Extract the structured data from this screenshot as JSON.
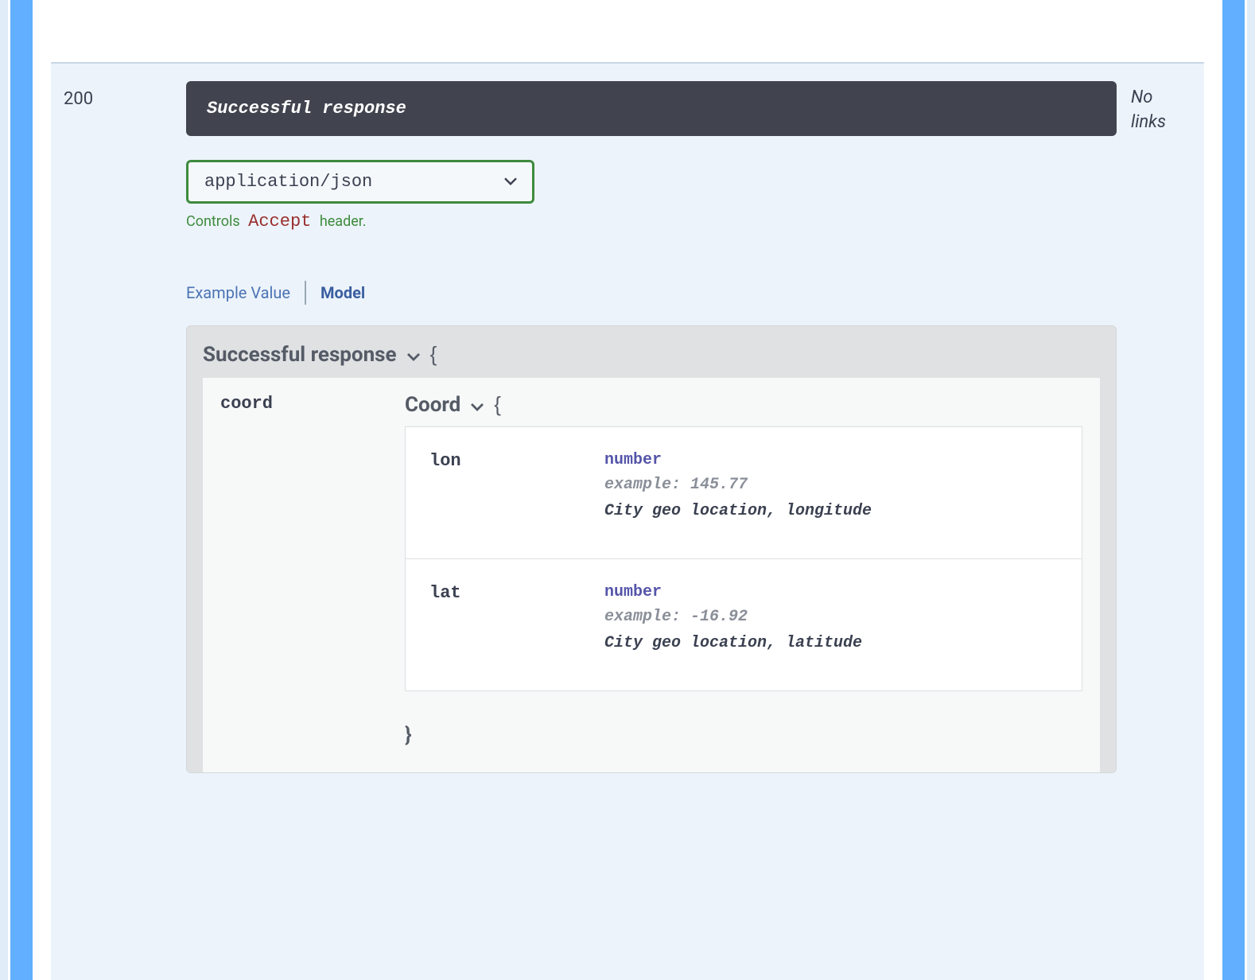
{
  "response": {
    "code": "200",
    "description": "Successful response",
    "links_text": "No links"
  },
  "media_type": {
    "selected": "application/json",
    "hint_controls": "Controls",
    "hint_accept": "Accept",
    "hint_header": "header."
  },
  "tabs": {
    "example_value": "Example Value",
    "model": "Model"
  },
  "model": {
    "title": "Successful response",
    "open_brace": "{",
    "close_brace": "}",
    "properties": [
      {
        "name": "coord",
        "schema_title": "Coord",
        "fields": [
          {
            "name": "lon",
            "type": "number",
            "example_label": "example: 145.77",
            "description": "City geo location, longitude"
          },
          {
            "name": "lat",
            "type": "number",
            "example_label": "example: -16.92",
            "description": "City geo location, latitude"
          }
        ]
      }
    ]
  }
}
